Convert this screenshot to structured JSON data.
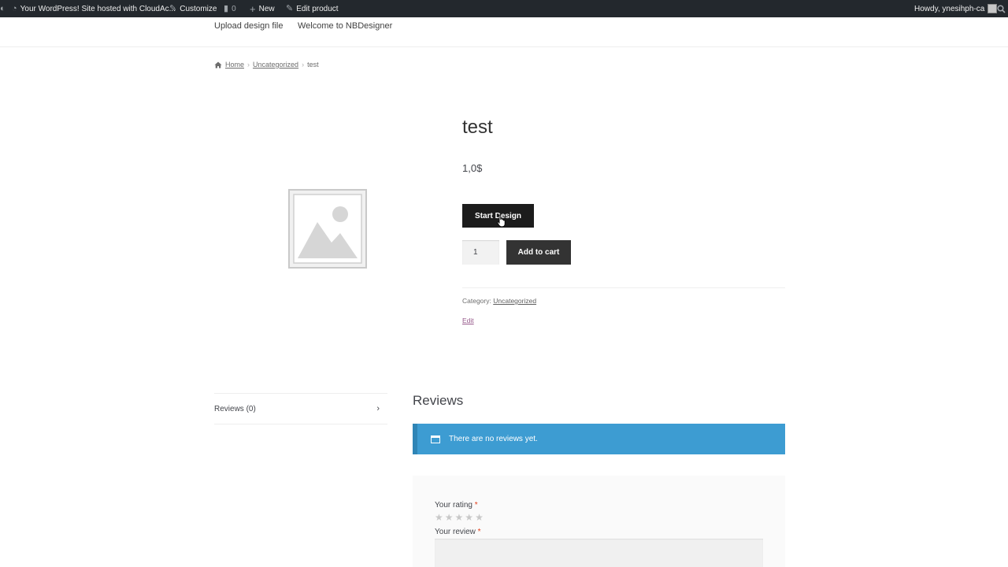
{
  "adminbar": {
    "site_title": "Your WordPress! Site hosted with CloudAc...",
    "customize": "Customize",
    "comments_count": "0",
    "new_label": "New",
    "edit_product": "Edit product",
    "howdy": "Howdy, ynesihph-ca"
  },
  "nav": {
    "items": [
      {
        "label": "Upload design file"
      },
      {
        "label": "Welcome to NBDesigner"
      }
    ]
  },
  "breadcrumb": {
    "home": "Home",
    "category": "Uncategorized",
    "current": "test"
  },
  "product": {
    "title": "test",
    "price": "1,0$",
    "start_design": "Start Design",
    "quantity": "1",
    "add_to_cart": "Add to cart",
    "category_label": "Category:",
    "category_value": "Uncategorized",
    "edit_label": "Edit"
  },
  "tabs": {
    "reviews_tab": "Reviews (0)"
  },
  "reviews": {
    "heading": "Reviews",
    "notice": "There are no reviews yet.",
    "rating_label": "Your rating",
    "review_label": "Your review",
    "required_mark": "*",
    "stars": [
      "★",
      "★",
      "★",
      "★",
      "★"
    ]
  },
  "colors": {
    "adminbar_bg": "#23282d",
    "notice_bg": "#3d9cd2",
    "button_bg": "#1c1c1c",
    "required": "#e2401c"
  }
}
